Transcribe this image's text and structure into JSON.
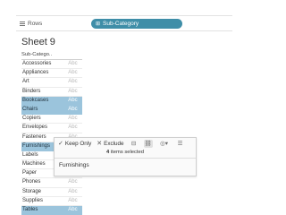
{
  "shelf": {
    "label": "Rows",
    "pill": "Sub-Category",
    "pill_icon": "dimension-icon",
    "pill_color": "#3f8ea8"
  },
  "sheet": {
    "title": "Sheet 9"
  },
  "table": {
    "header": "Sub-Catego..",
    "rows": [
      {
        "name": "Accessories",
        "abc": "Abc",
        "selected": false
      },
      {
        "name": "Appliances",
        "abc": "Abc",
        "selected": false
      },
      {
        "name": "Art",
        "abc": "Abc",
        "selected": false
      },
      {
        "name": "Binders",
        "abc": "Abc",
        "selected": false
      },
      {
        "name": "Bookcases",
        "abc": "Abc",
        "selected": true
      },
      {
        "name": "Chairs",
        "abc": "Abc",
        "selected": true
      },
      {
        "name": "Copiers",
        "abc": "Abc",
        "selected": false
      },
      {
        "name": "Envelopes",
        "abc": "Abc",
        "selected": false
      },
      {
        "name": "Fasteners",
        "abc": "Abc",
        "selected": false
      },
      {
        "name": "Furnishings",
        "abc": "Abc",
        "selected": true
      },
      {
        "name": "Labels",
        "abc": "Abc",
        "selected": false
      },
      {
        "name": "Machines",
        "abc": "Abc",
        "selected": false
      },
      {
        "name": "Paper",
        "abc": "Abc",
        "selected": false
      },
      {
        "name": "Phones",
        "abc": "Abc",
        "selected": false
      },
      {
        "name": "Storage",
        "abc": "Abc",
        "selected": false
      },
      {
        "name": "Supplies",
        "abc": "Abc",
        "selected": false
      },
      {
        "name": "Tables",
        "abc": "Abc",
        "selected": true
      }
    ],
    "selected_color": "#9bc4dc"
  },
  "tooltip": {
    "keep_only": "Keep Only",
    "exclude": "Exclude",
    "count_number": "4",
    "count_text": "items selected",
    "value": "Furnishings"
  }
}
